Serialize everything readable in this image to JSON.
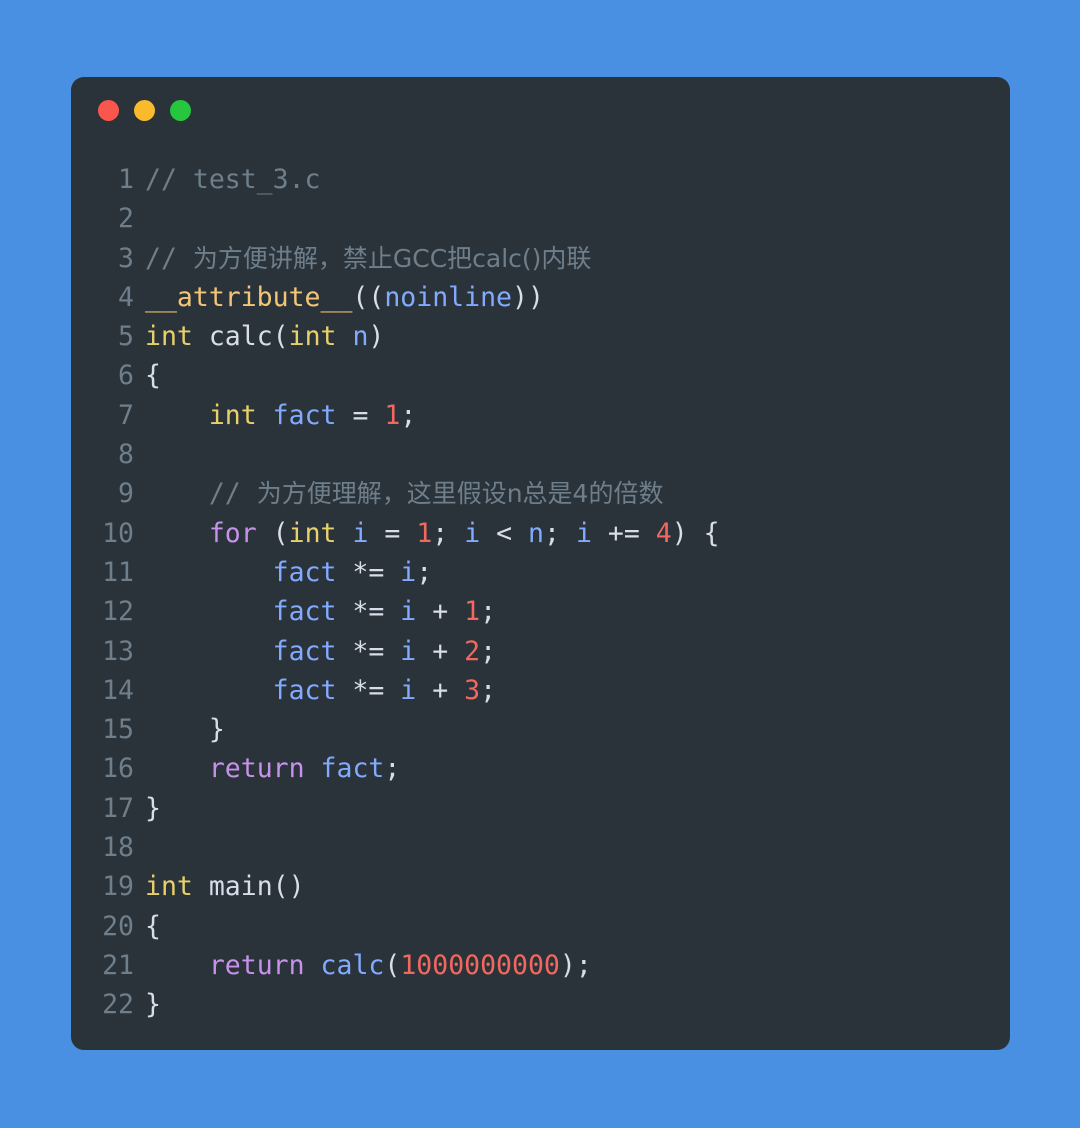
{
  "window": {
    "background_color": "#4a90e2",
    "card_color": "#2a323a",
    "traffic_lights": [
      {
        "name": "close",
        "color": "#f9574e"
      },
      {
        "name": "minimize",
        "color": "#f9bb2d"
      },
      {
        "name": "maximize",
        "color": "#27c63f"
      }
    ]
  },
  "editor": {
    "language": "c",
    "filename": "test_3.c",
    "first_line_number": 1,
    "last_line_number": 22,
    "gutter_color": "#6e7f8b",
    "lines": [
      {
        "n": "1",
        "tokens": [
          {
            "t": "// test_3.c",
            "c": "t-comment"
          }
        ]
      },
      {
        "n": "2",
        "tokens": []
      },
      {
        "n": "3",
        "tokens": [
          {
            "t": "// ",
            "c": "t-comment"
          },
          {
            "t": "为方便讲解，禁止GCC把calc()内联",
            "c": "t-comment cn"
          }
        ]
      },
      {
        "n": "4",
        "tokens": [
          {
            "t": "__attribute__",
            "c": "t-attr"
          },
          {
            "t": "((",
            "c": "t-plain"
          },
          {
            "t": "noinline",
            "c": "t-var"
          },
          {
            "t": "))",
            "c": "t-plain"
          }
        ]
      },
      {
        "n": "5",
        "tokens": [
          {
            "t": "int",
            "c": "t-type"
          },
          {
            "t": " calc(",
            "c": "t-plain"
          },
          {
            "t": "int",
            "c": "t-type"
          },
          {
            "t": " ",
            "c": "t-plain"
          },
          {
            "t": "n",
            "c": "t-var"
          },
          {
            "t": ")",
            "c": "t-plain"
          }
        ]
      },
      {
        "n": "6",
        "tokens": [
          {
            "t": "{",
            "c": "t-plain"
          }
        ]
      },
      {
        "n": "7",
        "tokens": [
          {
            "t": "    ",
            "c": "t-plain"
          },
          {
            "t": "int",
            "c": "t-type"
          },
          {
            "t": " ",
            "c": "t-plain"
          },
          {
            "t": "fact",
            "c": "t-var"
          },
          {
            "t": " = ",
            "c": "t-plain"
          },
          {
            "t": "1",
            "c": "t-num"
          },
          {
            "t": ";",
            "c": "t-plain"
          }
        ]
      },
      {
        "n": "8",
        "tokens": []
      },
      {
        "n": "9",
        "tokens": [
          {
            "t": "    // ",
            "c": "t-comment"
          },
          {
            "t": "为方便理解，这里假设n总是4的倍数",
            "c": "t-comment cn"
          }
        ]
      },
      {
        "n": "10",
        "tokens": [
          {
            "t": "    ",
            "c": "t-plain"
          },
          {
            "t": "for",
            "c": "t-kw"
          },
          {
            "t": " (",
            "c": "t-plain"
          },
          {
            "t": "int",
            "c": "t-type"
          },
          {
            "t": " ",
            "c": "t-plain"
          },
          {
            "t": "i",
            "c": "t-var"
          },
          {
            "t": " = ",
            "c": "t-plain"
          },
          {
            "t": "1",
            "c": "t-num"
          },
          {
            "t": "; ",
            "c": "t-plain"
          },
          {
            "t": "i",
            "c": "t-var"
          },
          {
            "t": " < ",
            "c": "t-plain"
          },
          {
            "t": "n",
            "c": "t-var"
          },
          {
            "t": "; ",
            "c": "t-plain"
          },
          {
            "t": "i",
            "c": "t-var"
          },
          {
            "t": " += ",
            "c": "t-plain"
          },
          {
            "t": "4",
            "c": "t-num"
          },
          {
            "t": ") {",
            "c": "t-plain"
          }
        ]
      },
      {
        "n": "11",
        "tokens": [
          {
            "t": "        ",
            "c": "t-plain"
          },
          {
            "t": "fact",
            "c": "t-var"
          },
          {
            "t": " *= ",
            "c": "t-plain"
          },
          {
            "t": "i",
            "c": "t-var"
          },
          {
            "t": ";",
            "c": "t-plain"
          }
        ]
      },
      {
        "n": "12",
        "tokens": [
          {
            "t": "        ",
            "c": "t-plain"
          },
          {
            "t": "fact",
            "c": "t-var"
          },
          {
            "t": " *= ",
            "c": "t-plain"
          },
          {
            "t": "i",
            "c": "t-var"
          },
          {
            "t": " + ",
            "c": "t-plain"
          },
          {
            "t": "1",
            "c": "t-num"
          },
          {
            "t": ";",
            "c": "t-plain"
          }
        ]
      },
      {
        "n": "13",
        "tokens": [
          {
            "t": "        ",
            "c": "t-plain"
          },
          {
            "t": "fact",
            "c": "t-var"
          },
          {
            "t": " *= ",
            "c": "t-plain"
          },
          {
            "t": "i",
            "c": "t-var"
          },
          {
            "t": " + ",
            "c": "t-plain"
          },
          {
            "t": "2",
            "c": "t-num"
          },
          {
            "t": ";",
            "c": "t-plain"
          }
        ]
      },
      {
        "n": "14",
        "tokens": [
          {
            "t": "        ",
            "c": "t-plain"
          },
          {
            "t": "fact",
            "c": "t-var"
          },
          {
            "t": " *= ",
            "c": "t-plain"
          },
          {
            "t": "i",
            "c": "t-var"
          },
          {
            "t": " + ",
            "c": "t-plain"
          },
          {
            "t": "3",
            "c": "t-num"
          },
          {
            "t": ";",
            "c": "t-plain"
          }
        ]
      },
      {
        "n": "15",
        "tokens": [
          {
            "t": "    }",
            "c": "t-plain"
          }
        ]
      },
      {
        "n": "16",
        "tokens": [
          {
            "t": "    ",
            "c": "t-plain"
          },
          {
            "t": "return",
            "c": "t-kw"
          },
          {
            "t": " ",
            "c": "t-plain"
          },
          {
            "t": "fact",
            "c": "t-var"
          },
          {
            "t": ";",
            "c": "t-plain"
          }
        ]
      },
      {
        "n": "17",
        "tokens": [
          {
            "t": "}",
            "c": "t-plain"
          }
        ]
      },
      {
        "n": "18",
        "tokens": []
      },
      {
        "n": "19",
        "tokens": [
          {
            "t": "int",
            "c": "t-type"
          },
          {
            "t": " main()",
            "c": "t-plain"
          }
        ]
      },
      {
        "n": "20",
        "tokens": [
          {
            "t": "{",
            "c": "t-plain"
          }
        ]
      },
      {
        "n": "21",
        "tokens": [
          {
            "t": "    ",
            "c": "t-plain"
          },
          {
            "t": "return",
            "c": "t-kw"
          },
          {
            "t": " ",
            "c": "t-plain"
          },
          {
            "t": "calc",
            "c": "t-fn"
          },
          {
            "t": "(",
            "c": "t-plain"
          },
          {
            "t": "1000000000",
            "c": "t-num"
          },
          {
            "t": ");",
            "c": "t-plain"
          }
        ]
      },
      {
        "n": "22",
        "tokens": [
          {
            "t": "}",
            "c": "t-plain"
          }
        ]
      }
    ]
  }
}
